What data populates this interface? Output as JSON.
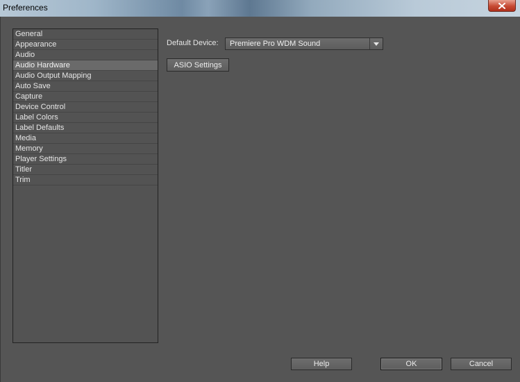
{
  "window": {
    "title": "Preferences"
  },
  "sidebar": {
    "items": [
      {
        "label": "General"
      },
      {
        "label": "Appearance"
      },
      {
        "label": "Audio"
      },
      {
        "label": "Audio Hardware",
        "selected": true
      },
      {
        "label": "Audio Output Mapping"
      },
      {
        "label": "Auto Save"
      },
      {
        "label": "Capture"
      },
      {
        "label": "Device Control"
      },
      {
        "label": "Label Colors"
      },
      {
        "label": "Label Defaults"
      },
      {
        "label": "Media"
      },
      {
        "label": "Memory"
      },
      {
        "label": "Player Settings"
      },
      {
        "label": "Titler"
      },
      {
        "label": "Trim"
      }
    ]
  },
  "audio_hardware": {
    "default_device_label": "Default Device:",
    "default_device_value": "Premiere Pro WDM Sound",
    "asio_button": "ASIO Settings"
  },
  "footer": {
    "help": "Help",
    "ok": "OK",
    "cancel": "Cancel"
  },
  "colors": {
    "panel_bg": "#555555",
    "selected_item": "#6a6a6a",
    "close_button": "#c74b34"
  },
  "icons": {
    "close": "close-icon",
    "dropdown": "chevron-down-icon"
  }
}
